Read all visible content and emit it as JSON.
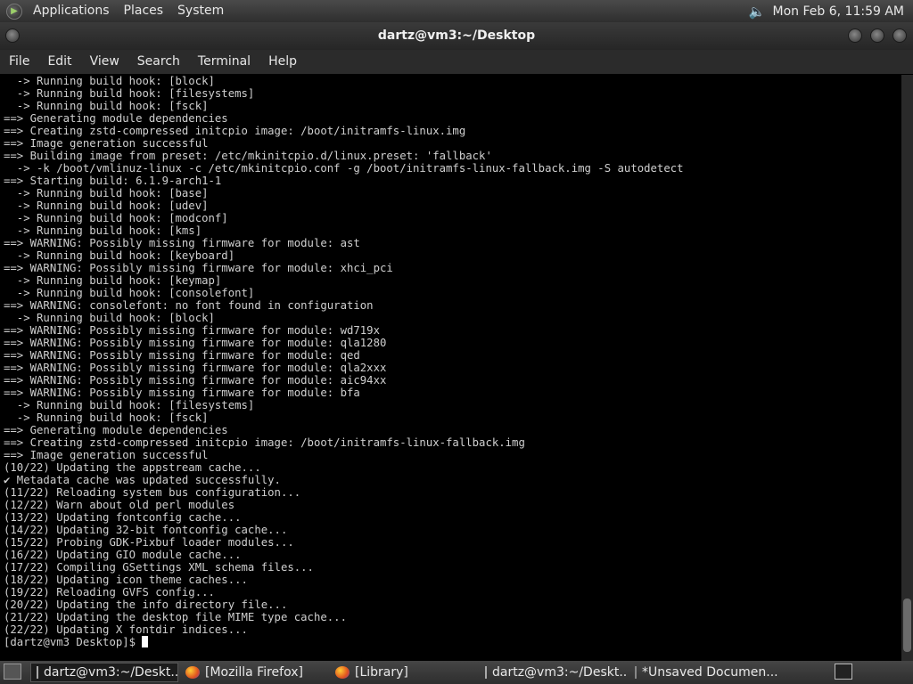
{
  "top_panel": {
    "menus": [
      "Applications",
      "Places",
      "System"
    ],
    "clock": "Mon Feb  6, 11:59 AM",
    "volume_icon": "speaker-icon"
  },
  "window": {
    "title": "dartz@vm3:~/Desktop"
  },
  "menubar": [
    "File",
    "Edit",
    "View",
    "Search",
    "Terminal",
    "Help"
  ],
  "terminal": {
    "lines": [
      "  -> Running build hook: [block]",
      "  -> Running build hook: [filesystems]",
      "  -> Running build hook: [fsck]",
      "==> Generating module dependencies",
      "==> Creating zstd-compressed initcpio image: /boot/initramfs-linux.img",
      "==> Image generation successful",
      "==> Building image from preset: /etc/mkinitcpio.d/linux.preset: 'fallback'",
      "  -> -k /boot/vmlinuz-linux -c /etc/mkinitcpio.conf -g /boot/initramfs-linux-fallback.img -S autodetect",
      "==> Starting build: 6.1.9-arch1-1",
      "  -> Running build hook: [base]",
      "  -> Running build hook: [udev]",
      "  -> Running build hook: [modconf]",
      "  -> Running build hook: [kms]",
      "==> WARNING: Possibly missing firmware for module: ast",
      "  -> Running build hook: [keyboard]",
      "==> WARNING: Possibly missing firmware for module: xhci_pci",
      "  -> Running build hook: [keymap]",
      "  -> Running build hook: [consolefont]",
      "==> WARNING: consolefont: no font found in configuration",
      "  -> Running build hook: [block]",
      "==> WARNING: Possibly missing firmware for module: wd719x",
      "==> WARNING: Possibly missing firmware for module: qla1280",
      "==> WARNING: Possibly missing firmware for module: qed",
      "==> WARNING: Possibly missing firmware for module: qla2xxx",
      "==> WARNING: Possibly missing firmware for module: aic94xx",
      "==> WARNING: Possibly missing firmware for module: bfa",
      "  -> Running build hook: [filesystems]",
      "  -> Running build hook: [fsck]",
      "==> Generating module dependencies",
      "==> Creating zstd-compressed initcpio image: /boot/initramfs-linux-fallback.img",
      "==> Image generation successful",
      "(10/22) Updating the appstream cache...",
      "✔ Metadata cache was updated successfully.",
      "(11/22) Reloading system bus configuration...",
      "(12/22) Warn about old perl modules",
      "(13/22) Updating fontconfig cache...",
      "(14/22) Updating 32-bit fontconfig cache...",
      "(15/22) Probing GDK-Pixbuf loader modules...",
      "(16/22) Updating GIO module cache...",
      "(17/22) Compiling GSettings XML schema files...",
      "(18/22) Updating icon theme caches...",
      "(19/22) Reloading GVFS config...",
      "(20/22) Updating the info directory file...",
      "(21/22) Updating the desktop file MIME type cache...",
      "(22/22) Updating X fontdir indices..."
    ],
    "prompt": "[dartz@vm3 Desktop]$ "
  },
  "taskbar": {
    "tasks": [
      {
        "label": "dartz@vm3:~/Deskt...",
        "icon": "terminal-icon"
      },
      {
        "label": "[Mozilla Firefox]",
        "icon": "firefox-icon"
      },
      {
        "label": "[Library]",
        "icon": "firefox-icon"
      },
      {
        "label": "dartz@vm3:~/Deskt...",
        "icon": "terminal-icon"
      },
      {
        "label": "*Unsaved Documen...",
        "icon": "text-editor-icon"
      }
    ]
  }
}
